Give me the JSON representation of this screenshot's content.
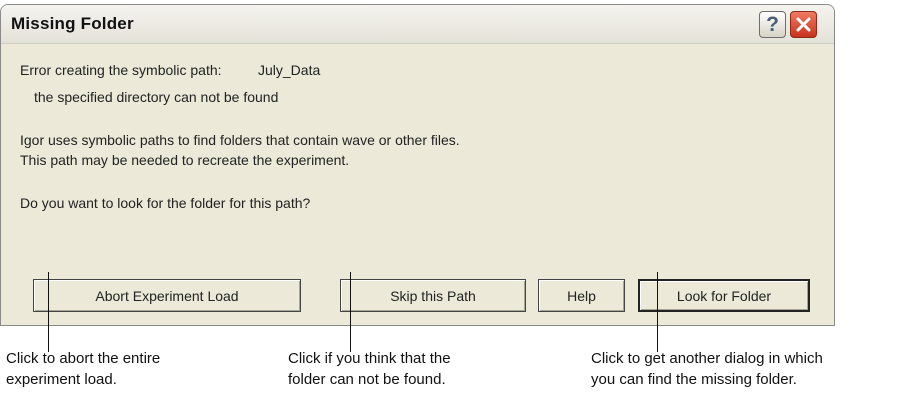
{
  "dialog": {
    "title": "Missing Folder",
    "help_icon": "question-mark-icon",
    "close_icon": "close-x-icon",
    "error_label": "Error creating the symbolic path:",
    "path_name": "July_Data",
    "error_detail": "the specified directory can not be found",
    "info_line1": "Igor uses symbolic paths to find folders that contain wave or other files.",
    "info_line2": "This path may be needed to recreate the experiment.",
    "question": "Do you want to look for the folder for this path?",
    "buttons": {
      "abort": "Abort Experiment Load",
      "skip": "Skip this Path",
      "help": "Help",
      "look": "Look for Folder"
    }
  },
  "callouts": [
    {
      "line1": "Click to abort the entire",
      "line2": "experiment load."
    },
    {
      "line1": "Click if you think that the",
      "line2": "folder can not be found."
    },
    {
      "line1": "Click to get another dialog in which",
      "line2": "you can find the missing folder."
    }
  ]
}
